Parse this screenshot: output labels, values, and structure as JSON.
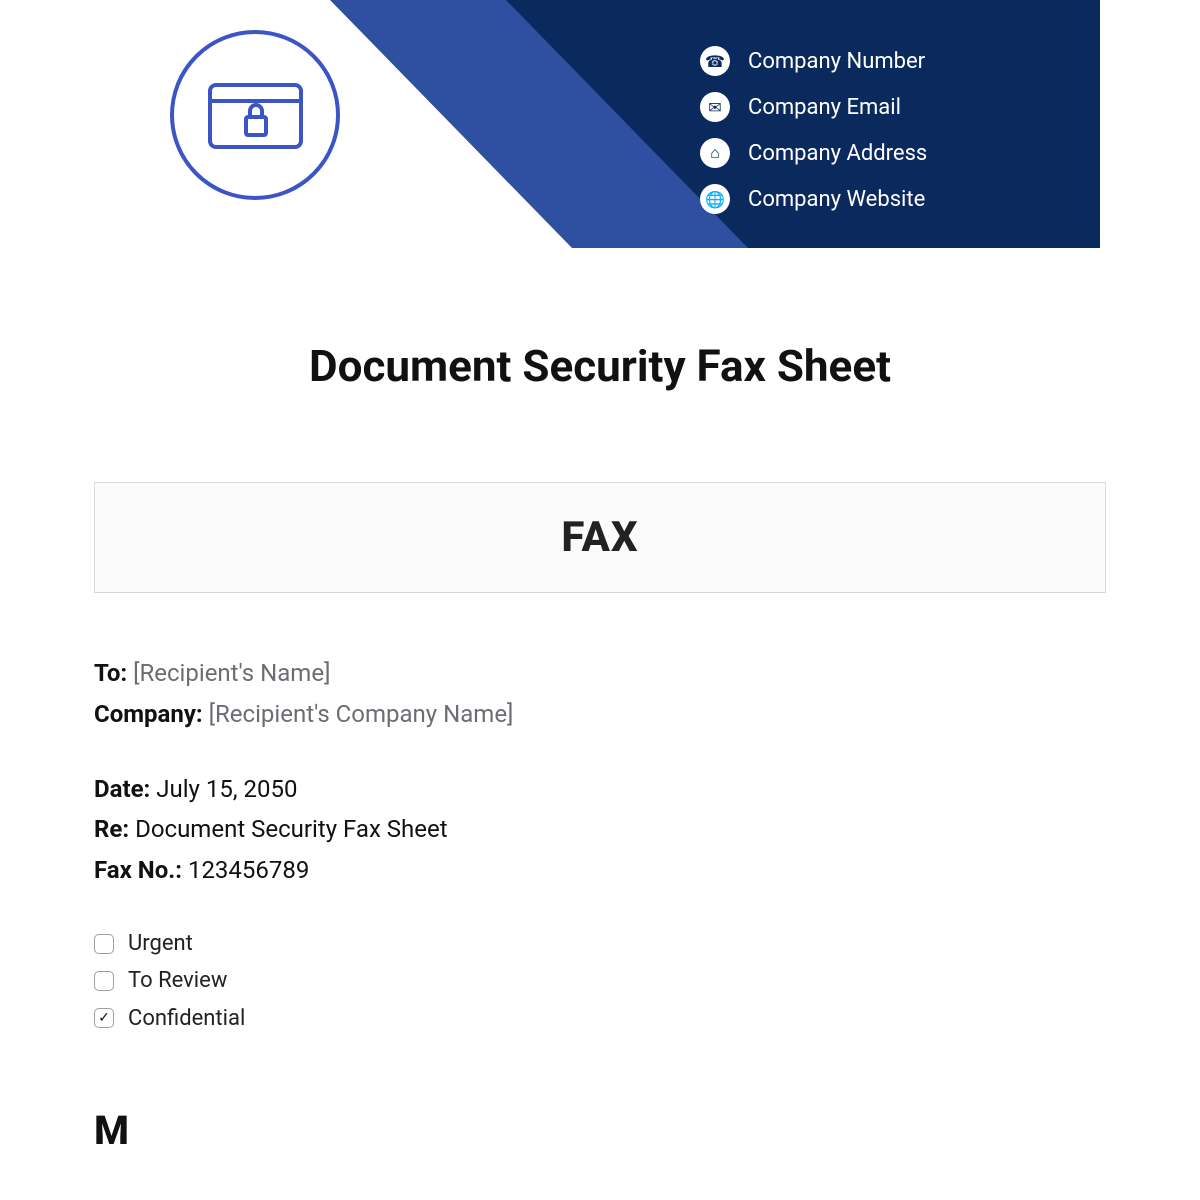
{
  "header": {
    "contacts": [
      {
        "icon": "phone-icon",
        "glyph": "☎",
        "label": "Company Number"
      },
      {
        "icon": "email-icon",
        "glyph": "✉",
        "label": "Company Email"
      },
      {
        "icon": "address-icon",
        "glyph": "⌂",
        "label": "Company Address"
      },
      {
        "icon": "website-icon",
        "glyph": "🌐",
        "label": "Company Website"
      }
    ]
  },
  "title": "Document Security Fax Sheet",
  "fax_box_label": "FAX",
  "fields": {
    "to_label": "To:",
    "to_value": "[Recipient's Name]",
    "company_label": "Company:",
    "company_value": "[Recipient's Company Name]",
    "date_label": "Date:",
    "date_value": "July 15, 2050",
    "re_label": "Re:",
    "re_value": "Document Security Fax Sheet",
    "faxno_label": "Fax No.:",
    "faxno_value": "123456789"
  },
  "checks": {
    "urgent": {
      "label": "Urgent",
      "checked": false
    },
    "to_review": {
      "label": "To Review",
      "checked": false
    },
    "confidential": {
      "label": "Confidential",
      "checked": true
    }
  },
  "message_heading_initial": "M"
}
